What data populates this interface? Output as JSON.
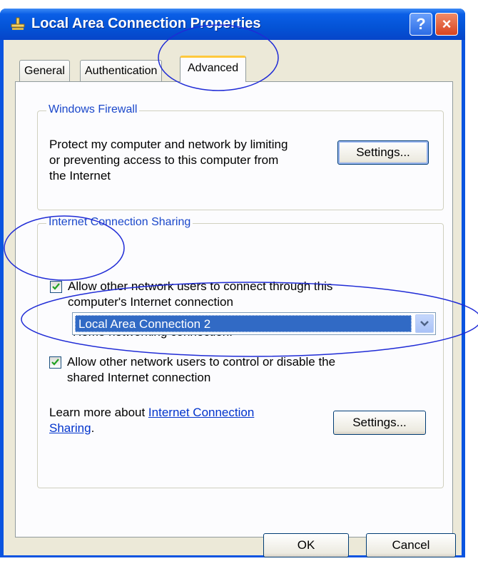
{
  "window": {
    "title": "Local Area Connection Properties",
    "help_label": "?",
    "close_label": "×"
  },
  "tabs": [
    {
      "label": "General"
    },
    {
      "label": "Authentication"
    },
    {
      "label": "Advanced",
      "selected": true
    }
  ],
  "firewall": {
    "group_label": "Windows Firewall",
    "description_lines": [
      "Protect my computer and network by limiting",
      "or preventing access to this computer from",
      "the Internet"
    ],
    "settings_button": "Settings..."
  },
  "sharing": {
    "group_label": "Internet Connection Sharing",
    "allow_connect": {
      "checked": true,
      "lines": [
        "Allow other network users to connect through this",
        "computer's Internet connection"
      ]
    },
    "home_connection_label": "Home networking connection:",
    "home_connection_value": "Local Area Connection 2",
    "allow_control": {
      "checked": true,
      "lines": [
        "Allow other network users to control or disable the",
        "shared Internet connection"
      ]
    },
    "learn_more_prefix": "Learn more about ",
    "learn_more_link_1": "Internet Connection",
    "learn_more_link_2": "Sharing",
    "learn_more_suffix": ".",
    "settings_button": "Settings..."
  },
  "footer": {
    "ok_button": "OK",
    "cancel_button": "Cancel"
  },
  "annotations": {
    "color": "#1f2bd6"
  }
}
